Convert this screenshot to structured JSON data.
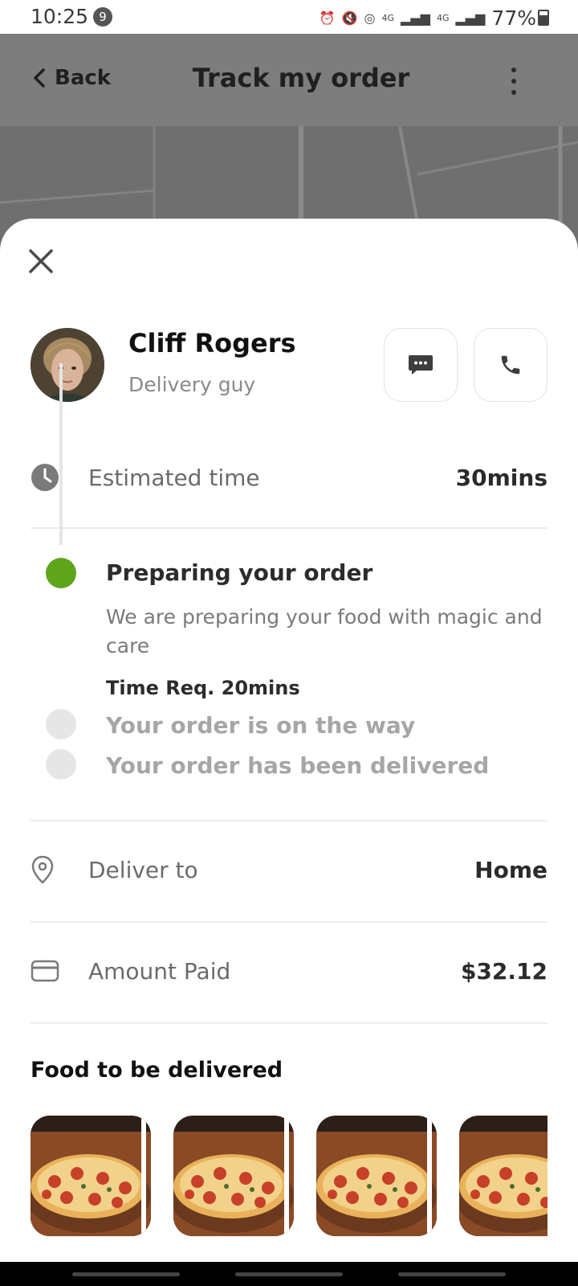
{
  "status_bar": {
    "time": "10:25",
    "notification_count": "9",
    "network_1": "4G",
    "network_2": "4G",
    "battery": "77%"
  },
  "header": {
    "back_label": "Back",
    "title": "Track my order"
  },
  "courier": {
    "name": "Cliff Rogers",
    "role": "Delivery guy"
  },
  "estimated": {
    "label": "Estimated time",
    "value": "30mins"
  },
  "timeline": {
    "steps": [
      {
        "title": "Preparing your order",
        "description": "We are preparing your food with magic and care",
        "time": "Time Req. 20mins",
        "state": "active"
      },
      {
        "title": "Your order is on the way",
        "state": "pending"
      },
      {
        "title": "Your order has been delivered",
        "state": "pending"
      }
    ]
  },
  "deliver_to": {
    "label": "Deliver to",
    "value": "Home"
  },
  "amount": {
    "label": "Amount Paid",
    "value": "$32.12"
  },
  "food": {
    "heading": "Food to be delivered",
    "items": [
      "pepperoni-pizza",
      "pepperoni-pizza",
      "pepperoni-pizza",
      "pepperoni-pizza"
    ]
  },
  "colors": {
    "accent_green": "#5ea51c",
    "header_gray": "#7d7d7d"
  }
}
